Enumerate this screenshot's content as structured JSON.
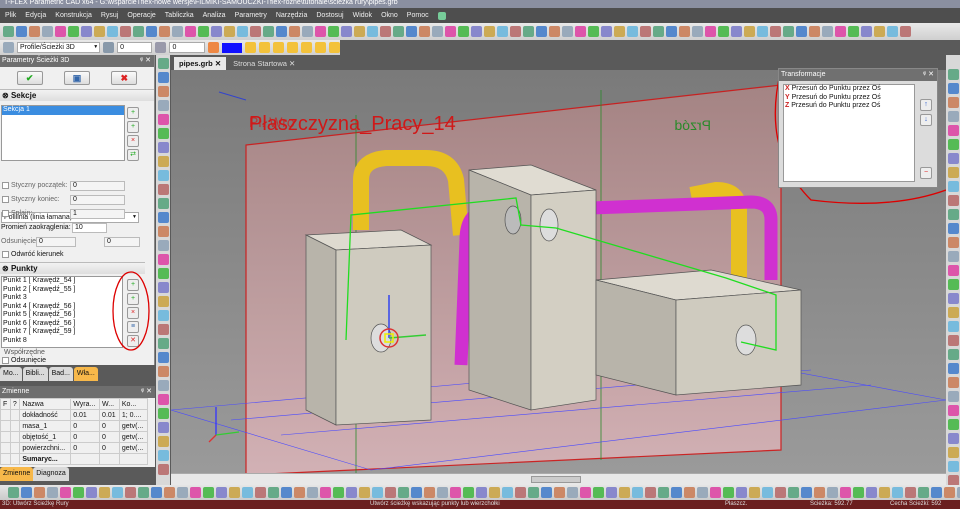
{
  "window_title": "T-FLEX Parametric CAD x64 - G:\\wsparcieTflex-nowe wersje\\FILMIKI-SAMOUCZKI-Tflex-rozne\\tutoriale\\sciezka rury\\pipes.grb",
  "menu": [
    "Plik",
    "Edycja",
    "Konstrukcja",
    "Rysuj",
    "Operacje",
    "Tabliczka",
    "Analiza",
    "Parametry",
    "Narzędzia",
    "Dostosuj",
    "Widok",
    "Okno",
    "Pomoc"
  ],
  "toolbar2": {
    "profile_select": "Profile/Ścieżki 3D",
    "layer_value": "0",
    "level_value": "0",
    "color": "#1010ff"
  },
  "left_panel": {
    "title": "Parametry Ścieżki 3D",
    "sections_header": "Sekcje",
    "sections": [
      "Sekcja 1"
    ],
    "type_select": "Polilinia (linia łamana)",
    "start_tangent_label": "Styczny początek:",
    "start_tangent_value": "0",
    "end_tangent_label": "Styczny koniec:",
    "end_tangent_value": "0",
    "spline_label": "Splajn:",
    "spline_value": "1",
    "radius_label": "Promień zaokrąglenia:",
    "radius_value": "10",
    "offset_label": "Odsunięcie:",
    "offset_value": "0",
    "offset_value2": "0",
    "reverse_label": "Odwróć kierunek",
    "points_header": "Punkty",
    "points": [
      "Punkt 1 [ Krawędź_54 ]",
      "Punkt 2 [ Krawędź_55 ]",
      "Punkt 3",
      "Punkt 4 [ Krawędź_56 ]",
      "Punkt 5 [ Krawędź_56 ]",
      "Punkt 6 [ Krawędź_56 ]",
      "Punkt 7 [ Krawędź_59 ]",
      "Punkt 8"
    ],
    "coords_label": "Współrzędne",
    "offset2_label": "Odsunięcie",
    "tabs": [
      "Mo...",
      "Bibli...",
      "Bad...",
      "Wła..."
    ]
  },
  "variables": {
    "title": "Zmienne",
    "headers": [
      "F",
      "?",
      "Nazwa",
      "Wyra...",
      "W...",
      "Ko..."
    ],
    "rows": [
      [
        "dokładność",
        "0.01",
        "0.01",
        "1; 0...."
      ],
      [
        "masa_1",
        "0",
        "0",
        "getv(..."
      ],
      [
        "objętość_1",
        "0",
        "0",
        "getv(..."
      ],
      [
        "powierzchni...",
        "0",
        "0",
        "getv(..."
      ],
      [
        "Sumaryc...",
        "",
        "",
        ""
      ]
    ],
    "tabs": [
      "Zmienne",
      "Diagnoza"
    ]
  },
  "doc_tabs": [
    "pipes.grb",
    "Strona Startowa"
  ],
  "scene": {
    "plane_front": "Pł. Wro",
    "plane_label": "Płaszczyzna_Pracy_14",
    "plane_right": "Przód"
  },
  "transformations": {
    "title": "Transformacje",
    "items": [
      {
        "axis": "X",
        "label": "Przesuń do Punktu przez Oś"
      },
      {
        "axis": "Y",
        "label": "Przesuń do Punktu przez Oś"
      },
      {
        "axis": "Z",
        "label": "Przesuń do Punktu przez Oś"
      }
    ]
  },
  "status": {
    "left": "3D: Utwórz Ścieżkę Rury",
    "middle": "Utwórz ścieżkę wskazując punkty lub wierzchołki",
    "right1": "Płaszcz.",
    "right2": "Ścieżka: 592.77",
    "right3": "Cecha Ścieżki: 592"
  }
}
